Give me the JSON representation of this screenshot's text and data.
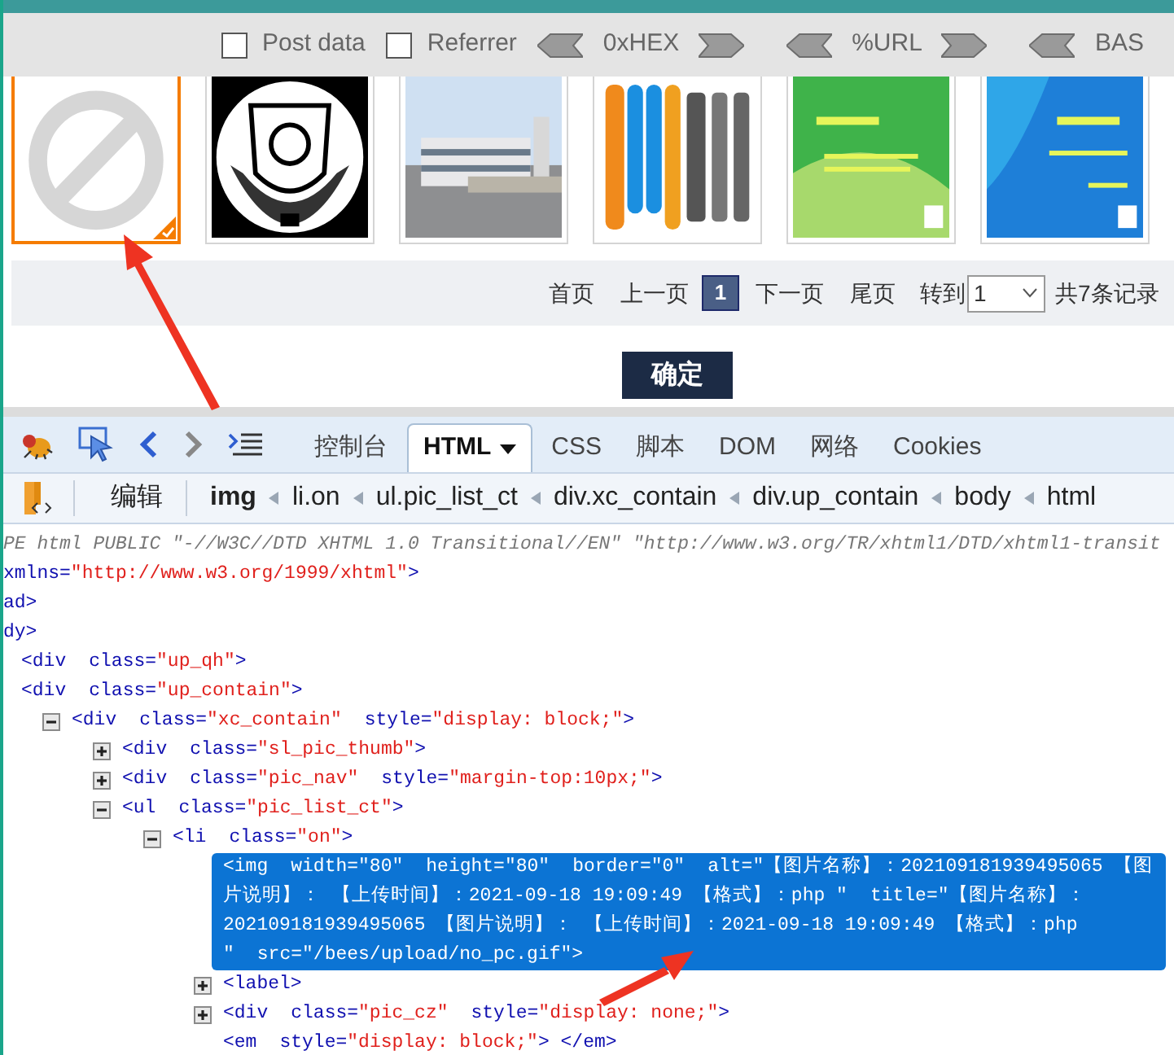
{
  "toolbar": {
    "checkboxes": [
      {
        "label": "Post data",
        "checked": false
      },
      {
        "label": "Referrer",
        "checked": false
      }
    ],
    "encoders": [
      {
        "label": "0xHEX"
      },
      {
        "label": "%URL"
      },
      {
        "label": "BAS"
      }
    ]
  },
  "thumbnails": [
    {
      "kind": "no-picture",
      "selected": true
    },
    {
      "kind": "emblem",
      "selected": false
    },
    {
      "kind": "building",
      "selected": false
    },
    {
      "kind": "bars",
      "selected": false
    },
    {
      "kind": "green-slide",
      "selected": false
    },
    {
      "kind": "blue-slide",
      "selected": false
    }
  ],
  "pagination": {
    "first": "首页",
    "prev": "上一页",
    "pages": [
      {
        "label": "1",
        "selected": true
      }
    ],
    "next": "下一页",
    "last": "尾页",
    "goto_label": "转到",
    "goto_value": "1",
    "total": "共7条记录"
  },
  "confirm_button": "确定",
  "firebug": {
    "tabs": [
      {
        "label": "控制台",
        "selected": false
      },
      {
        "label": "HTML",
        "selected": true
      },
      {
        "label": "CSS",
        "selected": false
      },
      {
        "label": "脚本",
        "selected": false
      },
      {
        "label": "DOM",
        "selected": false
      },
      {
        "label": "网络",
        "selected": false
      },
      {
        "label": "Cookies",
        "selected": false
      }
    ],
    "edit_button": "编辑",
    "breadcrumb": [
      {
        "label": "img",
        "selected": true
      },
      {
        "label": "li.on",
        "selected": false
      },
      {
        "label": "ul.pic_list_ct",
        "selected": false
      },
      {
        "label": "div.xc_contain",
        "selected": false
      },
      {
        "label": "div.up_contain",
        "selected": false
      },
      {
        "label": "body",
        "selected": false
      },
      {
        "label": "html",
        "selected": false
      }
    ],
    "top_lines": [
      {
        "kind": "doctype",
        "text": "PE html PUBLIC \"-//W3C//DTD XHTML 1.0 Transitional//EN\" \"http://www.w3.org/TR/xhtml1/DTD/xhtml1-transit"
      },
      {
        "kind": "attr",
        "name": "xmlns=",
        "value": "\"http://www.w3.org/1999/xhtml\"",
        "close": ">"
      },
      {
        "kind": "tag",
        "text": "ad>"
      },
      {
        "kind": "tag",
        "text": "dy>"
      }
    ],
    "tree": [
      {
        "open": "<div",
        "attrs": [
          {
            "name": "class=",
            "value": "\"up_qh\""
          }
        ],
        "close": ">"
      },
      {
        "open": "<div",
        "attrs": [
          {
            "name": "class=",
            "value": "\"up_contain\""
          }
        ],
        "close": ">",
        "children": [
          {
            "open": "<div",
            "attrs": [
              {
                "name": "class=",
                "value": "\"xc_contain\""
              },
              {
                "name": "style=",
                "value": "\"display: block;\""
              }
            ],
            "close": ">",
            "expanded": true,
            "children": [
              {
                "open": "<div",
                "attrs": [
                  {
                    "name": "class=",
                    "value": "\"sl_pic_thumb\""
                  }
                ],
                "close": ">",
                "expanded": false
              },
              {
                "open": "<div",
                "attrs": [
                  {
                    "name": "class=",
                    "value": "\"pic_nav\""
                  },
                  {
                    "name": "style=",
                    "value": "\"margin-top:10px;\""
                  }
                ],
                "close": ">",
                "expanded": false
              },
              {
                "open": "<ul",
                "attrs": [
                  {
                    "name": "class=",
                    "value": "\"pic_list_ct\""
                  }
                ],
                "close": ">",
                "expanded": true,
                "children": [
                  {
                    "open": "<li",
                    "attrs": [
                      {
                        "name": "class=",
                        "value": "\"on\""
                      }
                    ],
                    "close": ">",
                    "expanded": true,
                    "children": [
                      {
                        "open": "<img",
                        "attrs": [
                          {
                            "name": "width=",
                            "value": "\"80\""
                          },
                          {
                            "name": "height=",
                            "value": "\"80\""
                          },
                          {
                            "name": "border=",
                            "value": "\"0\""
                          },
                          {
                            "name": "alt=",
                            "value": "\"【图片名称】：202109181939495065 【图片说明】： 【上传时间】：2021-09-18 19:09:49 【格式】：php \""
                          },
                          {
                            "name": "title=",
                            "value": "\"【图片名称】：202109181939495065 【图片说明】： 【上传时间】：2021-09-18 19:09:49 【格式】：php \""
                          },
                          {
                            "name": "src=",
                            "value": "\"/bees/upload/no_pc.gif\""
                          }
                        ],
                        "close": ">",
                        "selected": true
                      },
                      {
                        "open": "<label",
                        "close": ">",
                        "expanded": false
                      },
                      {
                        "open": "<div",
                        "attrs": [
                          {
                            "name": "class=",
                            "value": "\"pic_cz\""
                          },
                          {
                            "name": "style=",
                            "value": "\"display: none;\""
                          }
                        ],
                        "close": ">",
                        "expanded": false
                      },
                      {
                        "open": "<em",
                        "attrs": [
                          {
                            "name": "style=",
                            "value": "\"display: block;\""
                          }
                        ],
                        "close": "> </em>"
                      }
                    ]
                  }
                ]
              }
            ]
          }
        ]
      }
    ]
  }
}
